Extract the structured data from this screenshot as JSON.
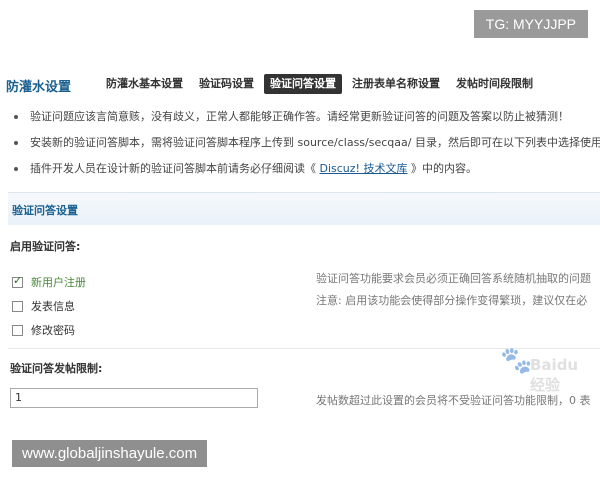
{
  "watermarks": {
    "top": "TG: MYYJJPP",
    "bottom": "www.globaljinshayule.com",
    "baidu": "Baidu 经验"
  },
  "header": {
    "title": "防灌水设置",
    "tabs": [
      {
        "label": "防灌水基本设置",
        "active": false
      },
      {
        "label": "验证码设置",
        "active": false
      },
      {
        "label": "验证问答设置",
        "active": true
      },
      {
        "label": "注册表单名称设置",
        "active": false
      },
      {
        "label": "发帖时间段限制",
        "active": false
      }
    ]
  },
  "tips": [
    "验证问题应该言简意赅，没有歧义，正常人都能够正确作答。请经常更新验证问答的问题及答案以防止被猜测！",
    "安装新的验证问答脚本，需将验证问答脚本程序上传到 source/class/secqaa/ 目录，然后即可在以下列表中选择使用",
    {
      "before": "插件开发人员在设计新的验证问答脚本前请务必仔细阅读《 ",
      "link": "Discuz! 技术文库",
      "after": " 》中的内容。"
    }
  ],
  "section": {
    "title": "验证问答设置",
    "enable_label": "启用验证问答:",
    "options": [
      {
        "label": "新用户注册",
        "checked": true
      },
      {
        "label": "发表信息",
        "checked": false
      },
      {
        "label": "修改密码",
        "checked": false
      }
    ],
    "enable_desc_1": "验证问答功能要求会员必须正确回答系统随机抽取的问题",
    "enable_desc_2": "注意: 启用该功能会使得部分操作变得繁琐，建议仅在必",
    "limit_label": "验证问答发帖限制:",
    "limit_value": "1",
    "limit_desc": "发帖数超过此设置的会员将不受验证问答功能限制，0 表"
  }
}
